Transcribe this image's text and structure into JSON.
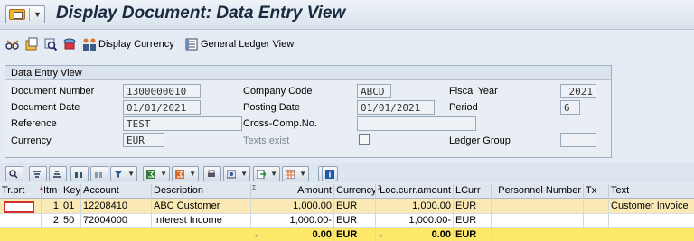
{
  "window": {
    "title": "Display Document: Data Entry View"
  },
  "toolbar": {
    "display_currency": "Display Currency",
    "general_ledger_view": "General Ledger View"
  },
  "header": {
    "group_title": "Data Entry View",
    "document_number": {
      "label": "Document Number",
      "value": "1300000010"
    },
    "company_code": {
      "label": "Company Code",
      "value": "ABCD"
    },
    "fiscal_year": {
      "label": "Fiscal Year",
      "value": "2021"
    },
    "document_date": {
      "label": "Document Date",
      "value": "01/01/2021"
    },
    "posting_date": {
      "label": "Posting Date",
      "value": "01/01/2021"
    },
    "period": {
      "label": "Period",
      "value": "6"
    },
    "reference": {
      "label": "Reference",
      "value": "TEST"
    },
    "cross_comp": {
      "label": "Cross-Comp.No.",
      "value": ""
    },
    "currency": {
      "label": "Currency",
      "value": "EUR"
    },
    "texts_exist": {
      "label": "Texts exist",
      "checked": false
    },
    "ledger_group": {
      "label": "Ledger Group",
      "value": ""
    }
  },
  "grid": {
    "columns": [
      "Tr.prt",
      "Itm",
      "Key",
      "Account",
      "Description",
      "Amount",
      "Currency",
      "Loc.curr.amount",
      "LCurr",
      "Personnel Number",
      "Tx",
      "Text"
    ],
    "rows": [
      {
        "itm": "1",
        "key": "01",
        "account": "12208410",
        "description": "ABC Customer",
        "amount": "1,000.00",
        "currency": "EUR",
        "loc_amount": "1,000.00",
        "lcurr": "EUR",
        "personnel": "",
        "tx": "",
        "text": "Customer Invoice"
      },
      {
        "itm": "2",
        "key": "50",
        "account": "72004000",
        "description": "Interest Income",
        "amount": "1,000.00-",
        "currency": "EUR",
        "loc_amount": "1,000.00-",
        "lcurr": "EUR",
        "personnel": "",
        "tx": "",
        "text": ""
      }
    ],
    "totals": {
      "amount": "0.00",
      "currency": "EUR",
      "loc_amount": "0.00",
      "lcurr": "EUR"
    }
  },
  "colors": {
    "selected_row": "#fbe9b5",
    "total_row": "#fde86a",
    "background": "#e4ebf3"
  }
}
